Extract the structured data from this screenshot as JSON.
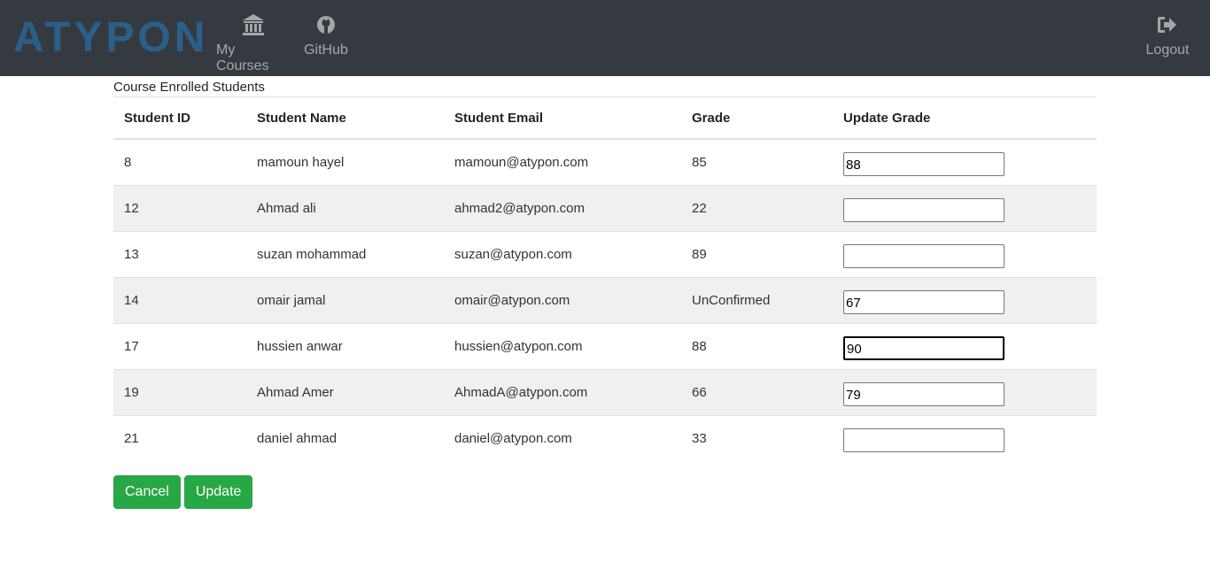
{
  "brand": {
    "logo_text": "ATYPON",
    "logo_color": "#2b5f8a"
  },
  "nav": {
    "courses": {
      "label": "My Courses",
      "icon": "bank-icon"
    },
    "github": {
      "label": "GitHub",
      "icon": "github-icon"
    },
    "logout": {
      "label": "Logout",
      "icon": "sign-out-icon"
    }
  },
  "table": {
    "caption": "Course Enrolled Students",
    "headers": {
      "id": "Student ID",
      "name": "Student Name",
      "email": "Student Email",
      "grade": "Grade",
      "update": "Update Grade"
    },
    "rows": [
      {
        "id": "8",
        "name": "mamoun hayel",
        "email": "mamoun@atypon.com",
        "grade": "85",
        "update": "88"
      },
      {
        "id": "12",
        "name": "Ahmad ali",
        "email": "ahmad2@atypon.com",
        "grade": "22",
        "update": ""
      },
      {
        "id": "13",
        "name": "suzan mohammad",
        "email": "suzan@atypon.com",
        "grade": "89",
        "update": ""
      },
      {
        "id": "14",
        "name": "omair jamal",
        "email": "omair@atypon.com",
        "grade": "UnConfirmed",
        "update": "67"
      },
      {
        "id": "17",
        "name": "hussien anwar",
        "email": "hussien@atypon.com",
        "grade": "88",
        "update": "90"
      },
      {
        "id": "19",
        "name": "Ahmad Amer",
        "email": "AhmadA@atypon.com",
        "grade": "66",
        "update": "79"
      },
      {
        "id": "21",
        "name": "daniel ahmad",
        "email": "daniel@atypon.com",
        "grade": "33",
        "update": ""
      }
    ]
  },
  "actions": {
    "cancel_label": "Cancel",
    "update_label": "Update"
  },
  "colors": {
    "navbar": "#343a40",
    "button": "#28a745",
    "stripe": "#f0f0f0"
  }
}
